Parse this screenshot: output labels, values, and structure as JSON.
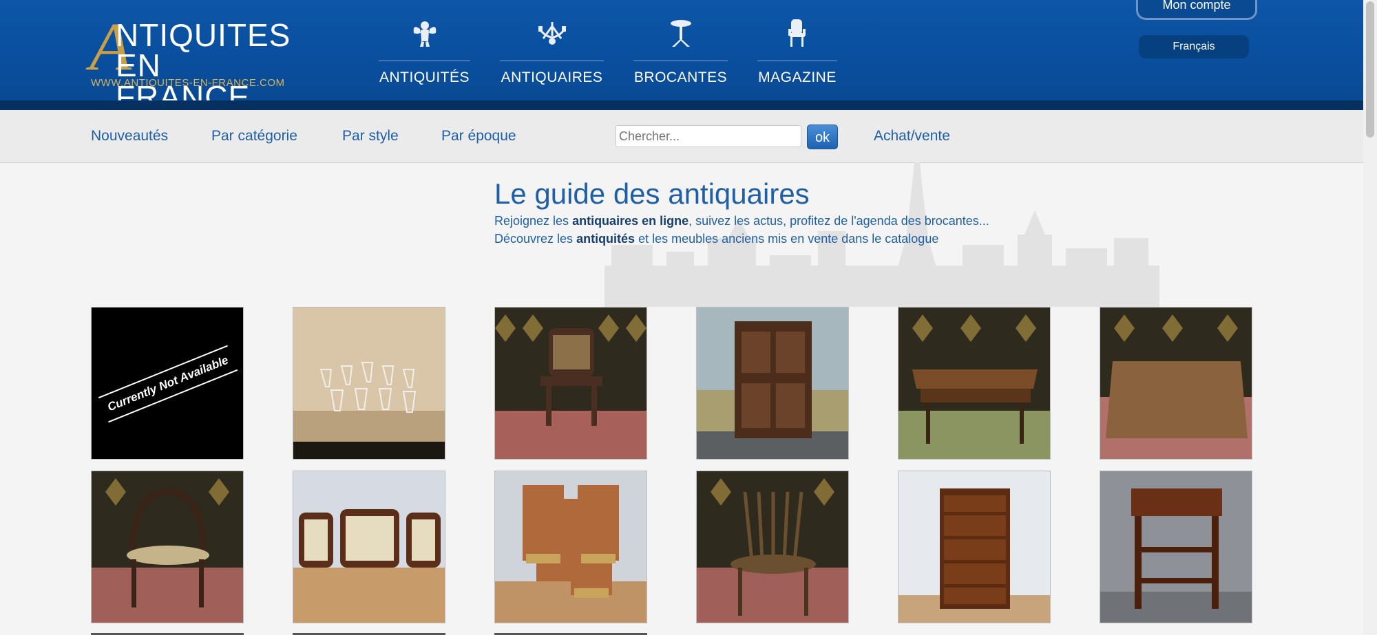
{
  "logo": {
    "letter": "A",
    "line1": "NTIQUITES",
    "line2": "EN FRANCE",
    "url": "WWW.ANTIQUITES-EN-FRANCE.COM"
  },
  "mainnav": [
    {
      "label": "ANTIQUITÉS",
      "icon": "cherub-icon"
    },
    {
      "label": "ANTIQUAIRES",
      "icon": "chandelier-icon"
    },
    {
      "label": "BROCANTES",
      "icon": "pedestal-table-icon"
    },
    {
      "label": "MAGAZINE",
      "icon": "armchair-icon"
    }
  ],
  "account": {
    "label": "Mon compte"
  },
  "language": {
    "label": "Français"
  },
  "subnav": {
    "links": [
      "Nouveautés",
      "Par catégorie",
      "Par style",
      "Par époque"
    ],
    "search_placeholder": "Chercher...",
    "search_button": "ok",
    "sell_link": "Achat/vente"
  },
  "hero": {
    "title": "Le guide des antiquaires",
    "line1_pre": "Rejoignez les ",
    "line1_bold": "antiquaires en ligne",
    "line1_post": ", suivez les actus, profitez de l'agenda des brocantes...",
    "line2_pre": "Découvrez les ",
    "line2_bold": "antiquités",
    "line2_post": " et les meubles anciens mis en vente dans le catalogue"
  },
  "products": [
    {
      "name": "unavailable",
      "overlay": "Currently Not Available"
    },
    {
      "name": "crystal-glasses"
    },
    {
      "name": "cane-chair"
    },
    {
      "name": "oak-cupboard"
    },
    {
      "name": "writing-table-drawer"
    },
    {
      "name": "square-table"
    },
    {
      "name": "bentwood-chair"
    },
    {
      "name": "living-room-set"
    },
    {
      "name": "rush-chairs"
    },
    {
      "name": "windsor-chair"
    },
    {
      "name": "chest-of-drawers"
    },
    {
      "name": "side-cabinet"
    }
  ],
  "colors": {
    "header": "#0a4d9c",
    "accent": "#1f5fa5",
    "gold": "#c9a047"
  }
}
